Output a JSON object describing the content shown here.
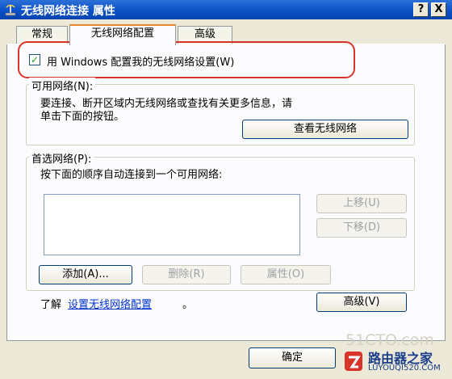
{
  "window": {
    "title": "无线网络连接 属性",
    "help_button": "?",
    "close_button": "X"
  },
  "tabs": [
    {
      "label": "常规"
    },
    {
      "label": "无线网络配置"
    },
    {
      "label": "高级"
    }
  ],
  "use_windows": {
    "label": "用 Windows 配置我的无线网络设置(W)",
    "checked": true,
    "check_glyph": "✓"
  },
  "available": {
    "title": "可用网络(N):",
    "line1": "要连接、断开区域内无线网络或查找有关更多信息，请",
    "line2": "单击下面的按钮。",
    "view_button": "查看无线网络"
  },
  "preferred": {
    "title": "首选网络(P):",
    "hint": "按下面的顺序自动连接到一个可用网络:",
    "move_up": "上移(U)",
    "move_down": "下移(D)",
    "add": "添加(A)...",
    "remove": "删除(R)",
    "properties": "属性(O)"
  },
  "learn": {
    "prefix": "了解",
    "link": "设置无线网络配置",
    "suffix": "。"
  },
  "advanced_button": "高级(V)",
  "ok_button": "确定",
  "watermarks": {
    "site1": "51CTO.com",
    "site2": "路由器之家",
    "site3": "LUYOUQI520.COM"
  },
  "colors": {
    "titlebar": "#0a4fc4",
    "highlight_border": "#d9342b",
    "link": "#0033cc",
    "window_bg": "#ece9d8"
  }
}
